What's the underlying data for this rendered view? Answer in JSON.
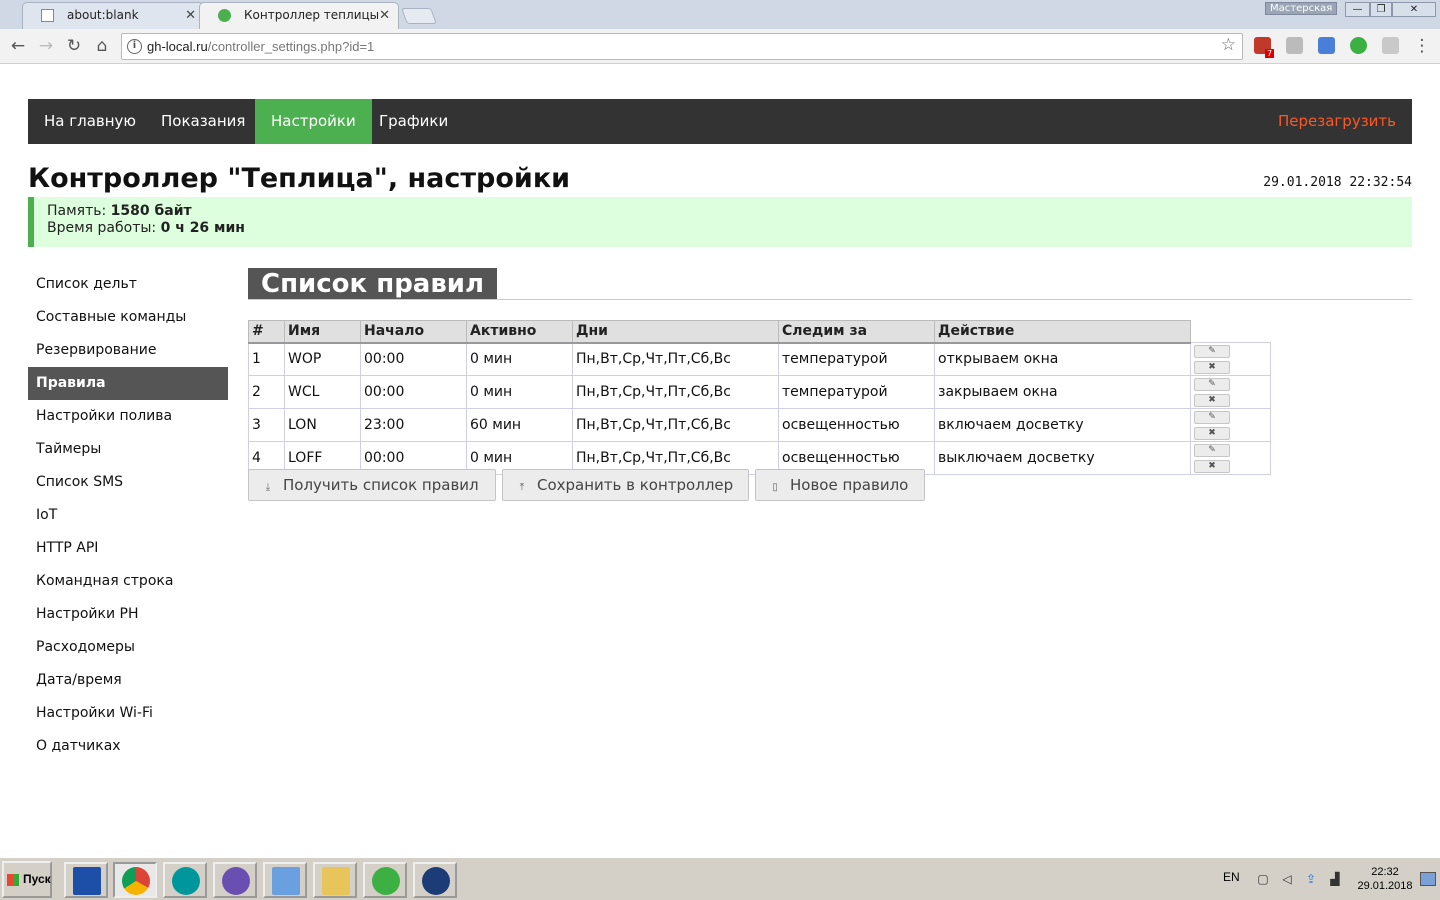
{
  "browser": {
    "tabs": [
      {
        "title": "about:blank",
        "icon": "page-icon"
      },
      {
        "title": "Контроллер теплицы",
        "icon": "leaf-icon"
      }
    ],
    "profile_badge": "Мастерская",
    "address": {
      "host": "gh-local.ru",
      "path": "/controller_settings.php?id=1"
    },
    "ext_badge": "7"
  },
  "nav": {
    "items": [
      {
        "label": "На главную"
      },
      {
        "label": "Показания"
      },
      {
        "label": "Настройки"
      },
      {
        "label": "Графики"
      }
    ],
    "active": "Настройки",
    "reboot_label": "Перезагрузить"
  },
  "header": {
    "title": "Контроллер \"Теплица\", настройки",
    "datetime": "29.01.2018 22:32:54"
  },
  "status": {
    "memory_label": "Память:",
    "memory_value": "1580 байт",
    "uptime_label": "Время работы:",
    "uptime_value": "0 ч 26 мин"
  },
  "sidebar": {
    "items": [
      {
        "label": "Список дельт"
      },
      {
        "label": "Составные команды"
      },
      {
        "label": "Резервирование"
      },
      {
        "label": "Правила"
      },
      {
        "label": "Настройки полива"
      },
      {
        "label": "Таймеры"
      },
      {
        "label": "Список SMS"
      },
      {
        "label": "IoT"
      },
      {
        "label": "HTTP API"
      },
      {
        "label": "Командная строка"
      },
      {
        "label": "Настройки PH"
      },
      {
        "label": "Расходомеры"
      },
      {
        "label": "Дата/время"
      },
      {
        "label": "Настройки Wi-Fi"
      },
      {
        "label": "О датчиках"
      }
    ],
    "active": "Правила"
  },
  "section": {
    "title": "Список правил",
    "columns": [
      "#",
      "Имя",
      "Начало",
      "Активно",
      "Дни",
      "Следим за",
      "Действие"
    ],
    "rows": [
      {
        "num": "1",
        "name": "WOP",
        "start": "00:00",
        "active": "0 мин",
        "days": "Пн,Вт,Ср,Чт,Пт,Сб,Вс",
        "watch": "температурой",
        "action": "открываем окна"
      },
      {
        "num": "2",
        "name": "WCL",
        "start": "00:00",
        "active": "0 мин",
        "days": "Пн,Вт,Ср,Чт,Пт,Сб,Вс",
        "watch": "температурой",
        "action": "закрываем окна"
      },
      {
        "num": "3",
        "name": "LON",
        "start": "23:00",
        "active": "60 мин",
        "days": "Пн,Вт,Ср,Чт,Пт,Сб,Вс",
        "watch": "освещенностью",
        "action": "включаем досветку"
      },
      {
        "num": "4",
        "name": "LOFF",
        "start": "00:00",
        "active": "0 мин",
        "days": "Пн,Вт,Ср,Чт,Пт,Сб,Вс",
        "watch": "освещенностью",
        "action": "выключаем досветку"
      }
    ],
    "buttons": [
      {
        "label": "Получить список правил",
        "icon": "download-icon"
      },
      {
        "label": "Сохранить в контроллер",
        "icon": "upload-icon"
      },
      {
        "label": "Новое правило",
        "icon": "new-document-icon"
      }
    ]
  },
  "taskbar": {
    "start_label": "Пуск",
    "lang": "EN",
    "time": "22:32",
    "date": "29.01.2018"
  },
  "colors": {
    "nav_bg": "#333333",
    "accent": "#4caf50",
    "reboot": "#ff5722",
    "status_bg": "#ddffdd",
    "section_bg": "#555555"
  }
}
